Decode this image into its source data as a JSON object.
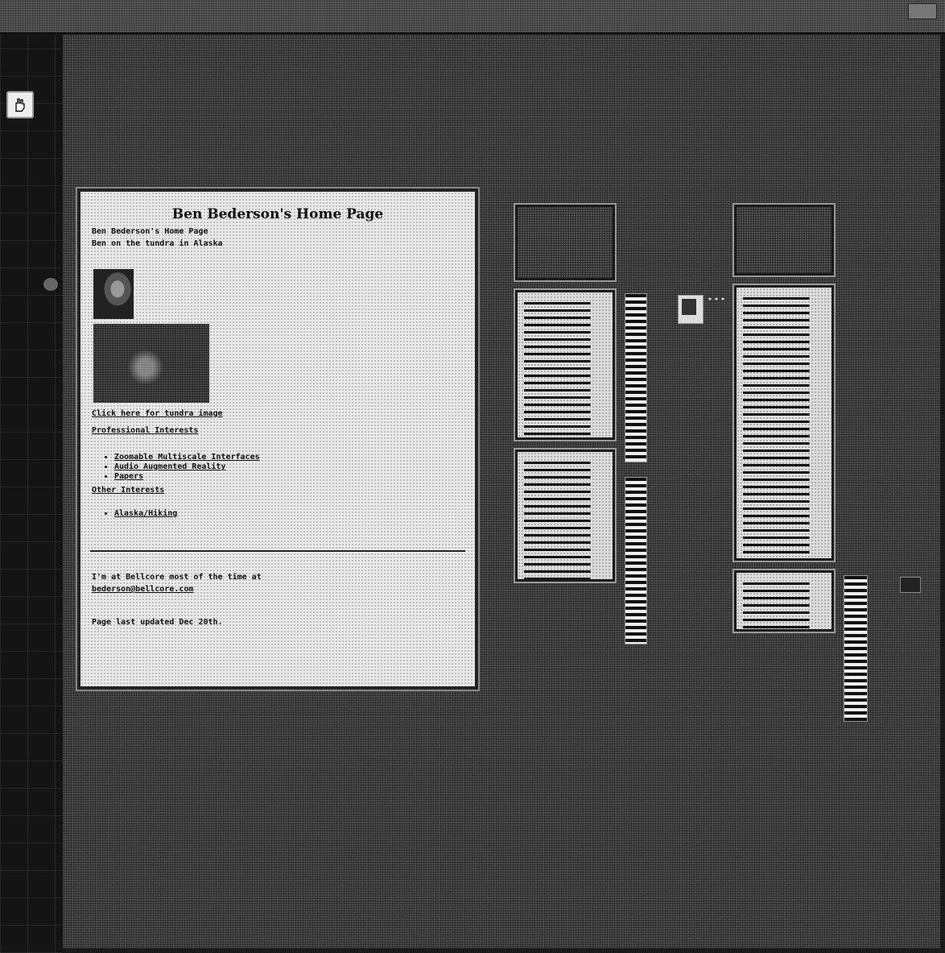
{
  "main_page": {
    "title": "Ben Bederson's Home Page",
    "subtitle": "Ben Bederson's Home Page",
    "caption_top": "Ben on the tundra in Alaska",
    "click_here": "Click here for tundra image",
    "professional_heading": "Professional Interests",
    "professional_items": [
      "Zoomable Multiscale Interfaces",
      "Audio Augmented Reality",
      "Papers"
    ],
    "other_heading": "Other Interests",
    "other_items": [
      "Alaska/Hiking"
    ],
    "footer_line": "I'm at Bellcore most of the time at",
    "footer_email": "bederson@bellcore.com",
    "last_updated": "Page last updated Dec 20th."
  },
  "thumbnails": {
    "thumb_top_left_title": "",
    "thumb_right_title": "Audio Augmented Reality",
    "thumb_bottom_right_title": "Ben Bederson's Home Page"
  },
  "colors": {
    "background": "#4d4d4d",
    "page": "#e9e9e9",
    "frame": "#222222"
  },
  "icons": {
    "tool_button": "hand-pointer-icon"
  }
}
